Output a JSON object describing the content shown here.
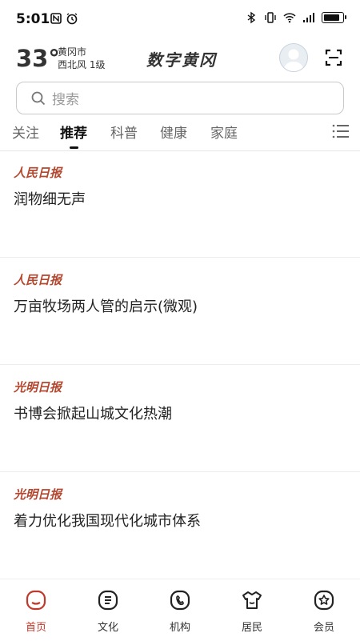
{
  "status": {
    "time": "5:01",
    "battery_level": 0.85
  },
  "header": {
    "temperature": "33°",
    "city": "黄冈市",
    "wind": "西北风  1级",
    "brand": "数字黄冈"
  },
  "search": {
    "placeholder": "搜索"
  },
  "tabs": [
    {
      "label": "关注"
    },
    {
      "label": "推荐",
      "active": true
    },
    {
      "label": "科普"
    },
    {
      "label": "健康"
    },
    {
      "label": "家庭"
    }
  ],
  "feed": [
    {
      "source": "人民日报",
      "title": "润物细无声"
    },
    {
      "source": "人民日报",
      "title": "万亩牧场两人管的启示(微观)"
    },
    {
      "source": "光明日报",
      "title": "书博会掀起山城文化热潮"
    },
    {
      "source": "光明日报",
      "title": "着力优化我国现代化城市体系"
    }
  ],
  "bottom_nav": [
    {
      "label": "首页",
      "icon": "home-icon",
      "active": true
    },
    {
      "label": "文化",
      "icon": "document-icon"
    },
    {
      "label": "机构",
      "icon": "phone-icon"
    },
    {
      "label": "居民",
      "icon": "shirt-icon"
    },
    {
      "label": "会员",
      "icon": "star-badge-icon"
    }
  ],
  "colors": {
    "accent": "#c0392b",
    "source_text": "#b4472f"
  }
}
